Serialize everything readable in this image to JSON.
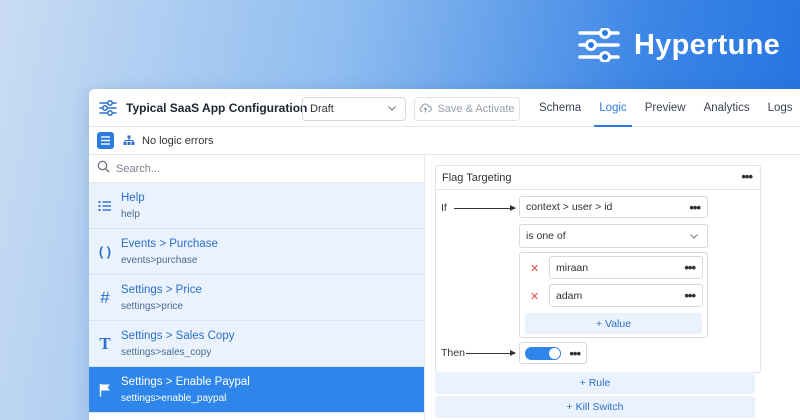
{
  "brand": {
    "name": "Hypertune"
  },
  "header": {
    "title": "Typical SaaS App Configuration",
    "branch_select": "Draft",
    "save_label": "Save & Activate",
    "tabs": [
      {
        "label": "Schema",
        "active": false
      },
      {
        "label": "Logic",
        "active": true
      },
      {
        "label": "Preview",
        "active": false
      },
      {
        "label": "Analytics",
        "active": false
      },
      {
        "label": "Logs",
        "active": false
      }
    ]
  },
  "status": {
    "text": "No logic errors"
  },
  "sidebar": {
    "search_placeholder": "Search...",
    "items": [
      {
        "icon": "list-icon",
        "label": "Help",
        "sub": "help",
        "active": false
      },
      {
        "icon": "braces-icon",
        "label": "Events > Purchase",
        "sub": "events>purchase",
        "active": false
      },
      {
        "icon": "hash-icon",
        "label": "Settings > Price",
        "sub": "settings>price",
        "active": false
      },
      {
        "icon": "text-type-icon",
        "label": "Settings > Sales Copy",
        "sub": "settings>sales_copy",
        "active": false
      },
      {
        "icon": "flag-icon",
        "label": "Settings > Enable Paypal",
        "sub": "settings>enable_paypal",
        "active": true
      }
    ]
  },
  "panel": {
    "title": "Flag Targeting",
    "if_label": "If",
    "then_label": "Then",
    "condition_field": "context > user > id",
    "operator": "is one of",
    "values": [
      "miraan",
      "adam"
    ],
    "add_value_label": "+ Value",
    "then_value": true
  },
  "actions": {
    "add_rule_label": "+ Rule",
    "add_kill_switch_label": "+ Kill Switch"
  },
  "colors": {
    "accent": "#2f86ea",
    "remove": "#e05050"
  }
}
